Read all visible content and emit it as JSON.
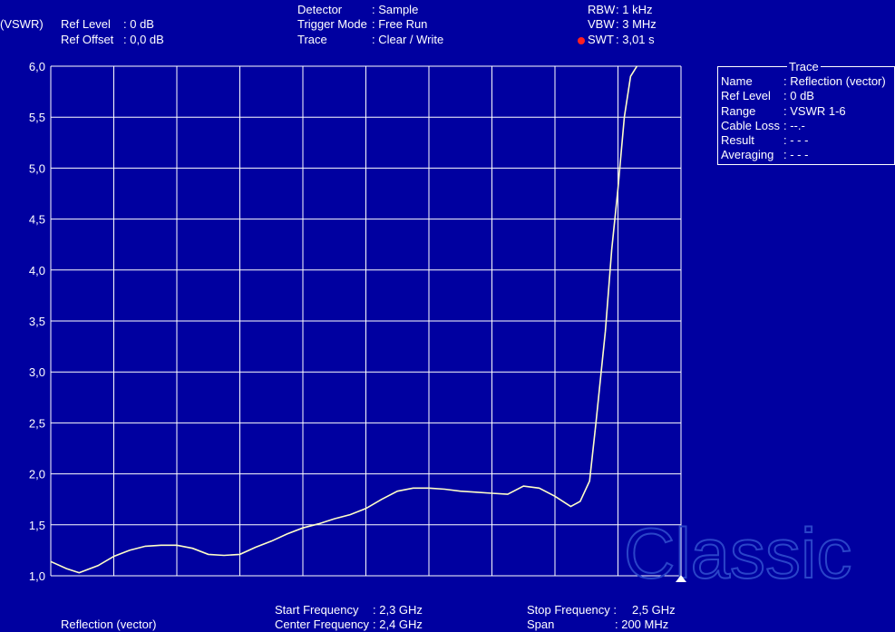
{
  "header": {
    "unit": "(VSWR)",
    "ref_level_label": "Ref Level",
    "ref_level_value": ": 0   dB",
    "ref_offset_label": "Ref Offset",
    "ref_offset_value": ": 0,0 dB",
    "detector_label": "Detector",
    "detector_value": ": Sample",
    "trigger_label": "Trigger Mode",
    "trigger_value": ": Free Run",
    "trace_label": "Trace",
    "trace_value": ": Clear / Write",
    "rbw_label": "RBW",
    "rbw_value": ": 1     kHz",
    "vbw_label": "VBW",
    "vbw_value": ": 3     MHz",
    "swt_label": "SWT",
    "swt_value": ": 3,01 s",
    "swt_dot_color": "#ff2020"
  },
  "trace_panel": {
    "title": "Trace",
    "rows": [
      {
        "key": "Name",
        "value": ": Reflection (vector)"
      },
      {
        "key": "Ref Level",
        "value": ": 0 dB"
      },
      {
        "key": "Range",
        "value": ": VSWR 1-6"
      },
      {
        "key": "Cable Loss",
        "value": ": --.-"
      },
      {
        "key": "Result",
        "value": ": - - -"
      },
      {
        "key": "Averaging",
        "value": ": - - -"
      }
    ]
  },
  "footer": {
    "measurement": "Reflection (vector)",
    "start_label": "Start Frequency",
    "start_value": ": 2,3 GHz",
    "center_label": "Center Frequency",
    "center_value": ": 2,4 GHz",
    "stop_label": "Stop Frequency :",
    "stop_value": "2,5 GHz",
    "span_label": "Span",
    "span_value": ": 200   MHz"
  },
  "watermark": "Classic",
  "colors": {
    "background": "#0000a0",
    "grid": "#ffffff",
    "trace": "#ffffc8",
    "text": "#ffffff",
    "watermark": "#2a44c8"
  },
  "chart_data": {
    "type": "line",
    "xlabel": "",
    "ylabel": "(VSWR)",
    "xlim": [
      2.3,
      2.5
    ],
    "ylim": [
      1.0,
      6.0
    ],
    "x_unit": "GHz",
    "y_ticks": [
      "1,0",
      "1,5",
      "2,0",
      "2,5",
      "3,0",
      "3,5",
      "4,0",
      "4,5",
      "5,0",
      "5,5",
      "6,0"
    ],
    "grid": true,
    "series": [
      {
        "x": [
          2.3,
          2.305,
          2.309,
          2.315,
          2.32,
          2.325,
          2.33,
          2.335,
          2.34,
          2.345,
          2.35,
          2.355,
          2.36,
          2.365,
          2.37,
          2.375,
          2.38,
          2.385,
          2.39,
          2.395,
          2.4,
          2.405,
          2.41,
          2.415,
          2.42,
          2.425,
          2.43,
          2.435,
          2.44,
          2.445,
          2.45,
          2.455,
          2.46,
          2.465,
          2.468,
          2.471,
          2.473,
          2.476,
          2.478,
          2.48,
          2.482,
          2.484,
          2.486
        ],
        "y": [
          1.14,
          1.07,
          1.03,
          1.1,
          1.19,
          1.25,
          1.29,
          1.3,
          1.3,
          1.27,
          1.21,
          1.2,
          1.21,
          1.28,
          1.34,
          1.41,
          1.47,
          1.51,
          1.56,
          1.6,
          1.66,
          1.75,
          1.83,
          1.86,
          1.86,
          1.85,
          1.83,
          1.82,
          1.81,
          1.8,
          1.88,
          1.86,
          1.78,
          1.68,
          1.73,
          1.93,
          2.5,
          3.4,
          4.2,
          4.8,
          5.5,
          5.9,
          6.0
        ]
      }
    ]
  }
}
